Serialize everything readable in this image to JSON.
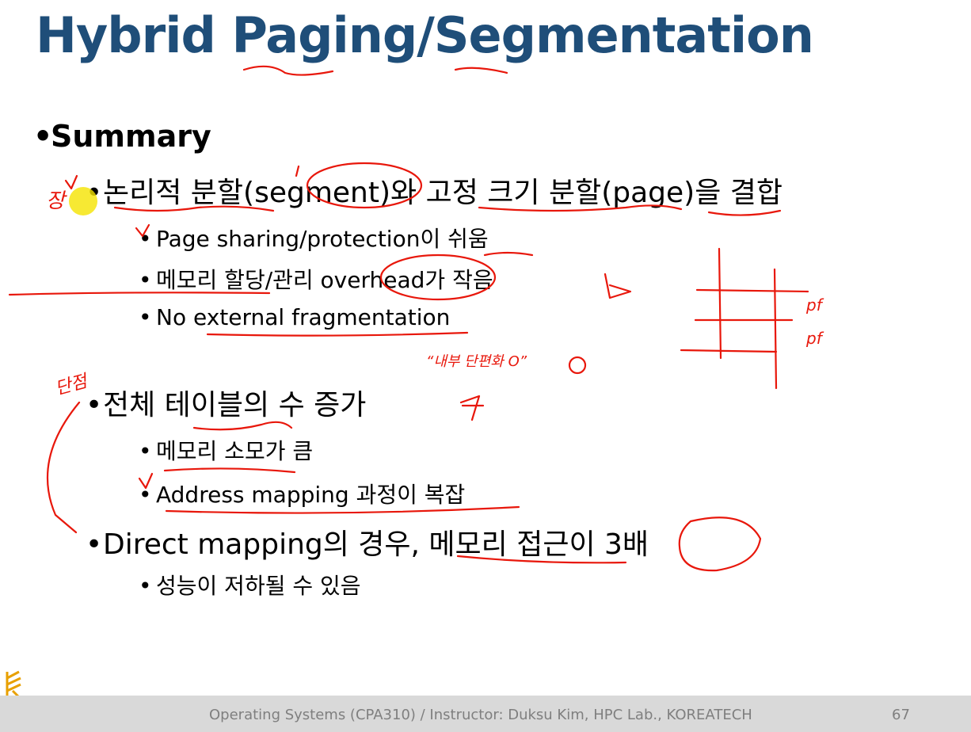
{
  "slide": {
    "title": "Hybrid Paging/Segmentation",
    "heading": "Summary",
    "items": [
      {
        "text": "논리적 분할(segment)와 고정 크기 분할(page)을 결합",
        "sub": [
          "Page sharing/protection이 쉬움",
          "메모리 할당/관리 overhead가 작음",
          "No external fragmentation"
        ]
      },
      {
        "text": "전체 테이블의 수 증가",
        "sub": [
          "메모리 소모가 큼",
          "Address mapping 과정이 복잡"
        ]
      },
      {
        "text": "Direct mapping의 경우, 메모리 접근이 3배",
        "sub": [
          "성능이 저하될 수 있음"
        ]
      }
    ]
  },
  "annotations": {
    "pro": "장",
    "con": "단점",
    "internal_frag": "“내부 단편화 O”",
    "pf1": "pf",
    "pf2": "pf"
  },
  "footer": {
    "text": "Operating Systems (CPA310) / Instructor: Duksu Kim, HPC Lab., KOREATECH",
    "page": "67"
  },
  "colors": {
    "title": "#1f4e79",
    "ink": "#e8170b",
    "highlight": "#f5e400",
    "footer_bg": "#d9d9d9"
  }
}
